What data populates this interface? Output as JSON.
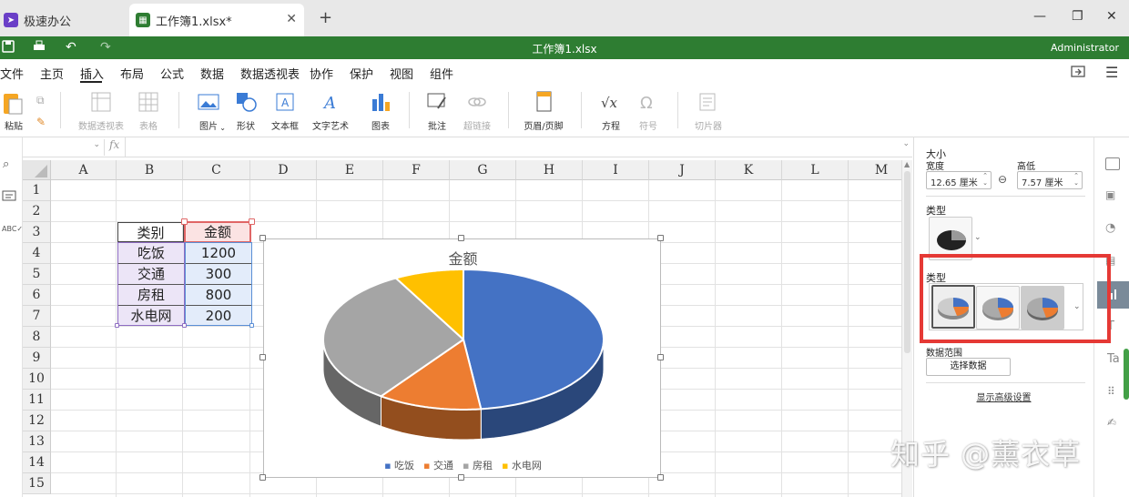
{
  "tabs": {
    "app": "极速办公",
    "doc": "工作簿1.xlsx*"
  },
  "titlebar": {
    "title": "工作簿1.xlsx",
    "user": "Administrator"
  },
  "menu": [
    "文件",
    "主页",
    "插入",
    "布局",
    "公式",
    "数据",
    "数据透视表",
    "协作",
    "保护",
    "视图",
    "组件"
  ],
  "ribbon": {
    "paste": "粘贴",
    "pivot": "数据透视表",
    "table": "表格",
    "image": "图片",
    "shape": "形状",
    "textbox": "文本框",
    "wordart": "文字艺术",
    "chart": "图表",
    "comment": "批注",
    "hyperlink": "超链接",
    "header": "页眉/页脚",
    "equation": "方程",
    "symbol": "符号",
    "slicer": "切片器"
  },
  "formula": {
    "fx": "fx"
  },
  "columns": [
    "A",
    "B",
    "C",
    "D",
    "E",
    "F",
    "G",
    "H",
    "I",
    "J",
    "K",
    "L",
    "M"
  ],
  "rows": [
    "1",
    "2",
    "3",
    "4",
    "5",
    "6",
    "7",
    "8",
    "9",
    "10",
    "11",
    "12",
    "13",
    "14",
    "15"
  ],
  "table": {
    "header": [
      "类别",
      "金额"
    ],
    "rows": [
      [
        "吃饭",
        "1200"
      ],
      [
        "交通",
        "300"
      ],
      [
        "房租",
        "800"
      ],
      [
        "水电网",
        "200"
      ]
    ]
  },
  "chart_data": {
    "type": "pie",
    "title": "金额",
    "categories": [
      "吃饭",
      "交通",
      "房租",
      "水电网"
    ],
    "values": [
      1200,
      300,
      800,
      200
    ],
    "colors": [
      "#4472c4",
      "#ed7d31",
      "#a5a5a5",
      "#ffc000"
    ],
    "style": "3d",
    "legend": "bottom"
  },
  "panel": {
    "size": "大小",
    "width_label": "宽度",
    "height_label": "高低",
    "width_value": "12.65 厘米",
    "height_value": "7.57 厘米",
    "type1": "类型",
    "type2": "类型",
    "data_range": "数据范围",
    "select_data": "选择数据",
    "advanced": "显示高级设置"
  },
  "watermark": "知乎 @薰衣草"
}
